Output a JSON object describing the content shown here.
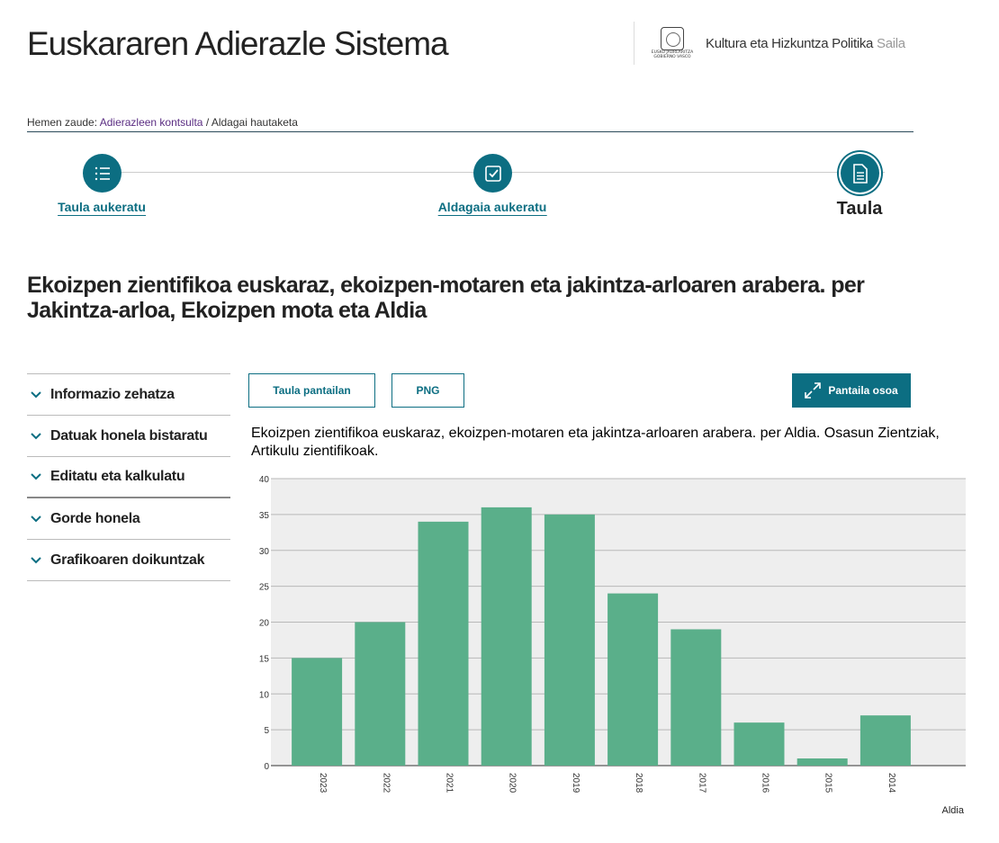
{
  "header": {
    "site_title": "Euskararen Adierazle Sistema",
    "gov_line1": "EUSKO JAURLARITZA",
    "gov_line2": "GOBIERNO VASCO",
    "department": "Kultura eta Hizkuntza Politika",
    "department_suffix": "Saila"
  },
  "breadcrumb": {
    "prefix": "Hemen zaude:",
    "link": "Adierazleen kontsulta",
    "separator": "/",
    "current": "Aldagai hautaketa"
  },
  "steps": [
    {
      "label": "Taula aukeratu",
      "icon": "list-icon"
    },
    {
      "label": "Aldagaia aukeratu",
      "icon": "checkbox-icon"
    },
    {
      "label": "Taula",
      "icon": "document-icon"
    }
  ],
  "main_title": "Ekoizpen zientifikoa euskaraz, ekoizpen-motaren eta jakintza-arloaren arabera. per Jakintza-arloa, Ekoizpen mota eta Aldia",
  "sidebar": {
    "items": [
      {
        "label": "Informazio zehatza"
      },
      {
        "label": "Datuak honela bistaratu"
      },
      {
        "label": "Editatu eta kalkulatu"
      },
      {
        "label": "Gorde honela"
      },
      {
        "label": "Grafikoaren doikuntzak"
      }
    ]
  },
  "toolbar": {
    "table_label": "Taula pantailan",
    "png_label": "PNG",
    "fullscreen_label": "Pantaila osoa"
  },
  "colors": {
    "accent": "#0c6e82",
    "bar": "#5aaf8a",
    "plot_bg": "#eeeeee"
  },
  "chart_data": {
    "type": "bar",
    "title": "Ekoizpen zientifikoa euskaraz, ekoizpen-motaren eta jakintza-arloaren arabera. per Aldia. Osasun Zientziak, Artikulu zientifikoak.",
    "categories": [
      "2023",
      "2022",
      "2021",
      "2020",
      "2019",
      "2018",
      "2017",
      "2016",
      "2015",
      "2014"
    ],
    "values": [
      15,
      20,
      34,
      36,
      35,
      24,
      19,
      6,
      1,
      7
    ],
    "xlabel": "Aldia",
    "ylabel": "",
    "ylim": [
      0,
      40
    ],
    "yticks": [
      0,
      5,
      10,
      15,
      20,
      25,
      30,
      35,
      40
    ],
    "grid": true,
    "legend": "none"
  }
}
